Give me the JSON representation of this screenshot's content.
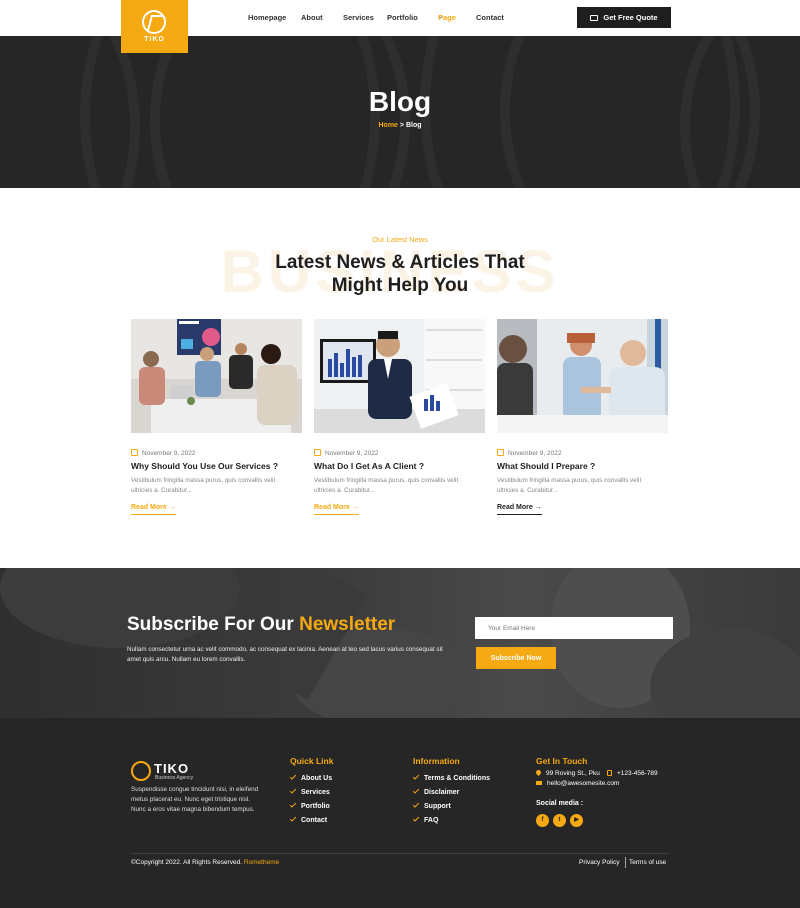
{
  "header": {
    "logo_text": "TIKO",
    "nav": [
      {
        "label": "Homepage",
        "caret": ""
      },
      {
        "label": "About",
        "caret": "⌄"
      },
      {
        "label": "Services",
        "caret": ""
      },
      {
        "label": "Portfolio",
        "caret": "⌄"
      },
      {
        "label": "Page",
        "caret": "⌄",
        "active": true
      },
      {
        "label": "Contact",
        "caret": ""
      }
    ],
    "quote_button": "Get Free Quote"
  },
  "hero": {
    "title": "Blog",
    "breadcrumb_home": "Home",
    "breadcrumb_sep": " > ",
    "breadcrumb_current": "Blog"
  },
  "latest": {
    "eyebrow": "Our Latest News",
    "watermark": "BUSINESS",
    "title_line1": "Latest News & Articles That",
    "title_line2": "Might Help You",
    "cards": [
      {
        "date": "November 9, 2022",
        "title": "Why Should You Use Our Services ?",
        "excerpt": "Vestibulum fringilla massa purus, quis convallis velit ultricies a. Curabitur...",
        "more": "Read More →",
        "more_color": "#f5a912"
      },
      {
        "date": "November 9, 2022",
        "title": "What Do I Get As A Client ?",
        "excerpt": "Vestibulum fringilla massa purus, quis convallis velit ultricies a. Curabitur...",
        "more": "Read More →",
        "more_color": "#f5a912"
      },
      {
        "date": "November 9, 2022",
        "title": "What Should I Prepare ?",
        "excerpt": "Vestibulum fringilla massa purus, quis convallis velit ultricies a. Curabitur...",
        "more": "Read More →",
        "more_color": "#1e1e1e"
      }
    ]
  },
  "newsletter": {
    "title_plain": "Subscribe For Our ",
    "title_highlight": "Newsletter",
    "text": "Nullam consectetur urna ac velit commodo, ac consequat ex lacinia. Aenean at leo sed lacus varius consequat sit amet quis arcu. Nullam eu lorem convallis.",
    "email_placeholder": "Your Email Here",
    "button": "Subscribe Now"
  },
  "footer": {
    "logo_name": "TIKO",
    "logo_sub": "Business Agency",
    "description": "Suspendisse congue tincidunt nisi, in eleifend metus placerat eu. Nunc eget tristique nisl. Nunc a eros vitae magna bibendum tempus.",
    "quick_link_head": "Quick Link",
    "quick_links": [
      "About Us",
      "Services",
      "Portfolio",
      "Contact"
    ],
    "info_head": "Information",
    "info_links": [
      "Terms & Conditions",
      "Disclaimer",
      "Support",
      "FAQ"
    ],
    "contact_head": "Get In Touch",
    "address": "99 Roving St., Pku",
    "phone": "+123-456-789",
    "email": "hello@awesomesite.com",
    "social_head": "Social media :",
    "social": [
      "f",
      "t",
      "▶"
    ],
    "copyright": "©Copyright 2022. All Rights Reserved. ",
    "copyright_brand": "Rometheme",
    "privacy": "Privacy Policy",
    "terms": "Terms of use"
  },
  "colors": {
    "accent": "#f5a912",
    "dark": "#262626"
  }
}
